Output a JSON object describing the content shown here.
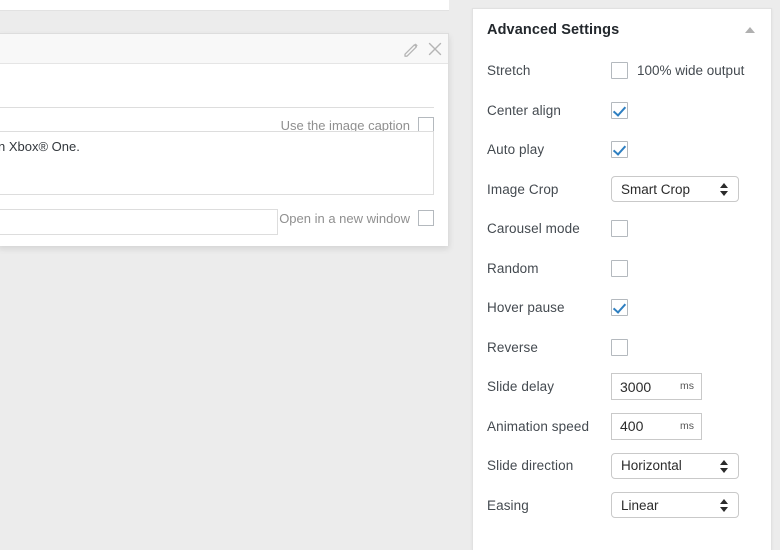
{
  "left_modal": {
    "edit_icon": "pencil-icon",
    "close_icon": "close-icon",
    "caption_checkbox_label": "Use the image caption",
    "caption_checkbox_checked": false,
    "caption_text": "n Xbox® One.",
    "new_window_label": "Open in a new window",
    "new_window_checked": false,
    "url_value": ""
  },
  "advanced_settings": {
    "title": "Advanced Settings",
    "collapse_icon": "chevron-up-icon",
    "rows": [
      {
        "label": "Stretch",
        "type": "checkbox",
        "checked": false,
        "caption": "100% wide output"
      },
      {
        "label": "Center align",
        "type": "checkbox",
        "checked": true,
        "caption": ""
      },
      {
        "label": "Auto play",
        "type": "checkbox",
        "checked": true,
        "caption": ""
      },
      {
        "label": "Image Crop",
        "type": "select",
        "value": "Smart Crop"
      },
      {
        "label": "Carousel mode",
        "type": "checkbox",
        "checked": false,
        "caption": ""
      },
      {
        "label": "Random",
        "type": "checkbox",
        "checked": false,
        "caption": ""
      },
      {
        "label": "Hover pause",
        "type": "checkbox",
        "checked": true,
        "caption": ""
      },
      {
        "label": "Reverse",
        "type": "checkbox",
        "checked": false,
        "caption": ""
      },
      {
        "label": "Slide delay",
        "type": "number",
        "value": "3000",
        "unit": "ms"
      },
      {
        "label": "Animation speed",
        "type": "number",
        "value": "400",
        "unit": "ms"
      },
      {
        "label": "Slide direction",
        "type": "select",
        "value": "Horizontal"
      },
      {
        "label": "Easing",
        "type": "select",
        "value": "Linear"
      }
    ]
  },
  "colors": {
    "accent": "#2e7fc1",
    "panel_bg": "#ffffff",
    "page_bg": "#ececec",
    "text": "#32373c",
    "muted": "#8f8f8f"
  }
}
